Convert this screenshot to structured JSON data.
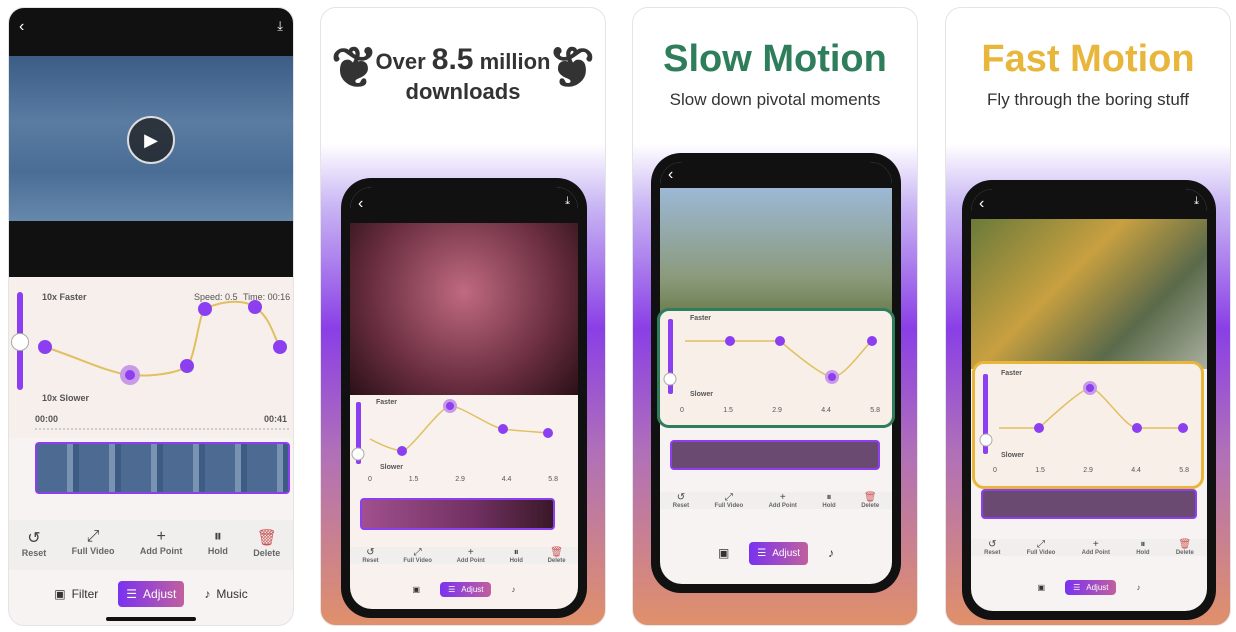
{
  "panel1": {
    "graph_top": "10x Faster",
    "graph_bottom": "10x Slower",
    "speed": "Speed: 0.5",
    "time": "Time: 00:16",
    "start": "00:00",
    "end": "00:41",
    "tools": [
      {
        "icon": "reset-icon",
        "glyph": "↺",
        "label": "Reset"
      },
      {
        "icon": "expand-icon",
        "glyph": "⤢",
        "label": "Full Video"
      },
      {
        "icon": "plus-icon",
        "glyph": "+",
        "label": "Add Point"
      },
      {
        "icon": "pause-icon",
        "glyph": "⏸",
        "label": "Hold"
      },
      {
        "icon": "trash-icon",
        "glyph": "🗑",
        "label": "Delete"
      }
    ],
    "nav": [
      {
        "icon": "filter-icon",
        "label": "Filter"
      },
      {
        "icon": "adjust-icon",
        "label": "Adjust"
      },
      {
        "icon": "music-icon",
        "label": "Music"
      }
    ]
  },
  "panel2": {
    "line1a": "Over ",
    "line1b": "8.5",
    "line1c": " million",
    "line2": "downloads",
    "graph_top": "Faster",
    "graph_bottom": "Slower",
    "ticks": [
      "0",
      "1.5",
      "2.9",
      "4.4",
      "5.8"
    ],
    "nav_active": "Adjust"
  },
  "panel3": {
    "title": "Slow Motion",
    "subtitle": "Slow down pivotal moments",
    "graph_top": "Faster",
    "graph_bottom": "Slower",
    "ticks": [
      "0",
      "1.5",
      "2.9",
      "4.4",
      "5.8"
    ],
    "nav_active": "Adjust",
    "title_color": "#2e7d5b"
  },
  "panel4": {
    "title": "Fast Motion",
    "subtitle": "Fly through the boring stuff",
    "graph_top": "Faster",
    "graph_bottom": "Slower",
    "ticks": [
      "0",
      "1.5",
      "2.9",
      "4.4",
      "5.8"
    ],
    "nav_active": "Adjust",
    "title_color": "#e8b63a"
  },
  "colors": {
    "accent": "#8b3ff0",
    "curve": "#e0c060"
  }
}
